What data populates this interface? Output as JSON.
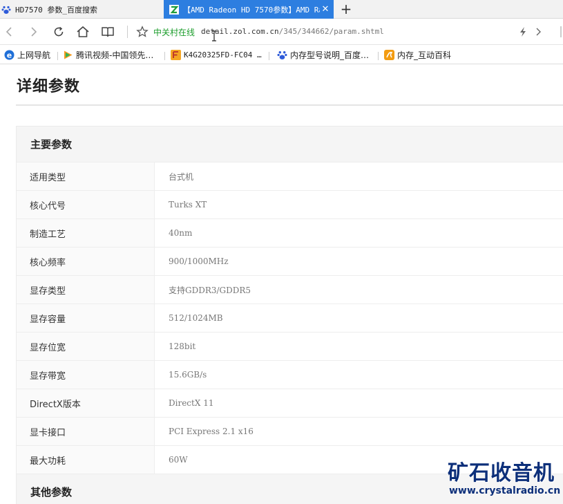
{
  "tabs": [
    {
      "title": "HD7570 参数_百度搜索",
      "icon": "baidu-paw-icon"
    },
    {
      "title": "【AMD Radeon HD 7570参数】AMD Ra",
      "icon": "zol-z-icon",
      "close": "✕"
    }
  ],
  "new_tab_symbol": "+",
  "address": {
    "site_name": "中关村在线",
    "url_host": "detail.zol.com.cn",
    "url_path": "/345/344662/param.shtml"
  },
  "bookmarks": [
    {
      "label": "上网导航",
      "icon": "ie-e-icon"
    },
    {
      "label": "腾讯视频-中国领先…",
      "icon": "tencent-video-icon"
    },
    {
      "label": "K4G20325FD-FC04 …",
      "icon": "zol-f-icon"
    },
    {
      "label": "内存型号说明_百度…",
      "icon": "baidu-paw-icon"
    },
    {
      "label": "内存_互动百科",
      "icon": "hudong-icon"
    }
  ],
  "page": {
    "title": "详细参数",
    "sections": [
      {
        "heading": "主要参数",
        "rows": [
          {
            "key": "适用类型",
            "value": "台式机"
          },
          {
            "key": "核心代号",
            "value": "Turks XT"
          },
          {
            "key": "制造工艺",
            "value": "40nm"
          },
          {
            "key": "核心频率",
            "value": "900/1000MHz"
          },
          {
            "key": "显存类型",
            "value": "支持GDDR3/GDDR5"
          },
          {
            "key": "显存容量",
            "value": "512/1024MB"
          },
          {
            "key": "显存位宽",
            "value": "128bit"
          },
          {
            "key": "显存带宽",
            "value": "15.6GB/s"
          },
          {
            "key": "DirectX版本",
            "value": "DirectX 11"
          },
          {
            "key": "显卡接口",
            "value": "PCI Express 2.1 x16"
          },
          {
            "key": "最大功耗",
            "value": "60W"
          }
        ]
      },
      {
        "heading": "其他参数",
        "rows": []
      }
    ]
  },
  "watermark": {
    "cn": "矿石收音机",
    "en": "www.crystalradio.cn"
  },
  "colors": {
    "tab_active": "#2d7ee0",
    "site_name": "#1a9c2a",
    "watermark": "#0c2f7a"
  }
}
